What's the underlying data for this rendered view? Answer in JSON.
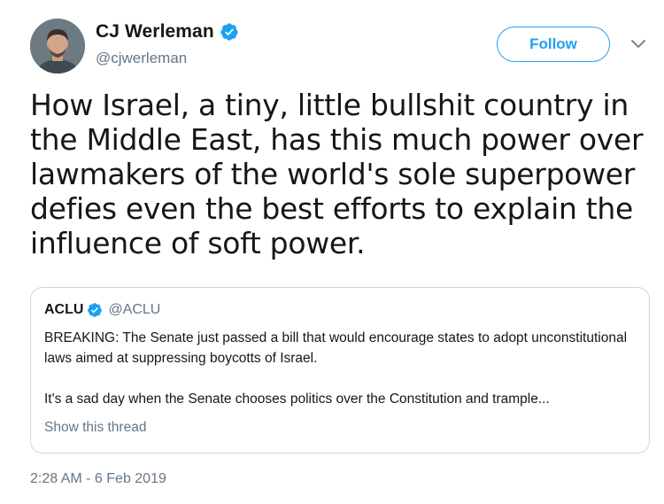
{
  "author": {
    "name": "CJ Werleman",
    "handle": "@cjwerleman",
    "verified": true
  },
  "follow_button": {
    "label": "Follow"
  },
  "tweet": {
    "text": "How Israel, a tiny, little bullshit country in the Middle East, has this much power over lawmakers of the world's sole superpower defies even the best efforts to explain the influence of soft power.",
    "timestamp": "2:28 AM - 6 Feb 2019"
  },
  "quoted_tweet": {
    "name": "ACLU",
    "handle": "@ACLU",
    "verified": true,
    "text": "BREAKING: The Senate just passed a bill that would encourage states to adopt unconstitutional laws aimed at suppressing boycotts of Israel.\n\nIt's a sad day when the Senate chooses politics over the Constitution and trample...",
    "show_thread_label": "Show this thread"
  },
  "colors": {
    "accent": "#1da1f2",
    "secondary_text": "#657786",
    "border": "#ccd6dd"
  }
}
